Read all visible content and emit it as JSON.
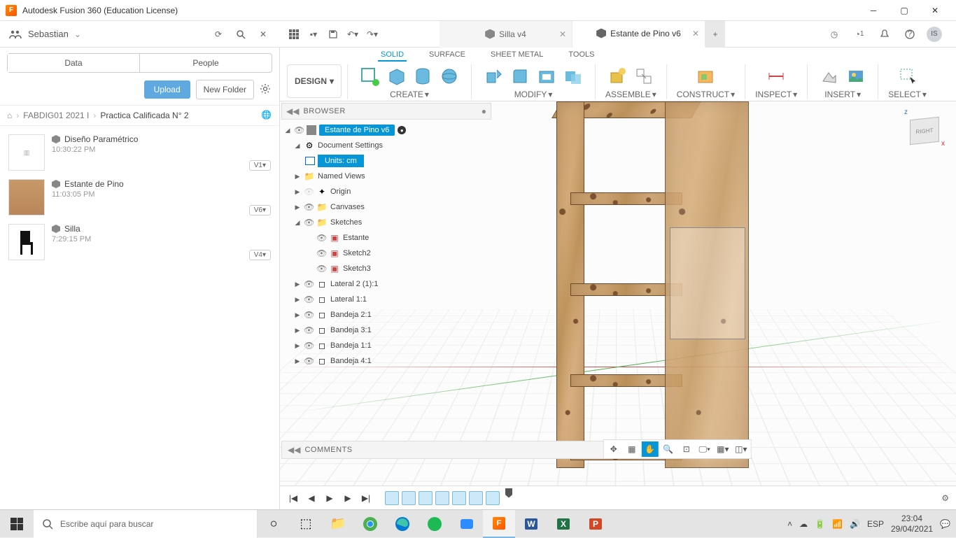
{
  "window": {
    "title": "Autodesk Fusion 360 (Education License)"
  },
  "user": {
    "name": "Sebastian",
    "initials": "IS",
    "notif_count": "1"
  },
  "doctabs": [
    {
      "label": "Silla v4",
      "active": false
    },
    {
      "label": "Estante de Pino v6",
      "active": true
    }
  ],
  "sidepanel": {
    "tabs": {
      "data": "Data",
      "people": "People"
    },
    "upload": "Upload",
    "newfolder": "New Folder",
    "crumbs": {
      "a": "FABDIG01 2021 I",
      "b": "Practica Calificada N° 2"
    },
    "files": [
      {
        "name": "Diseño Paramétrico",
        "time": "10:30:22 PM",
        "ver": "V1▾",
        "thumb": "param"
      },
      {
        "name": "Estante de Pino",
        "time": "11:03:05 PM",
        "ver": "V6▾",
        "thumb": "wood"
      },
      {
        "name": "Silla",
        "time": "7:29:15 PM",
        "ver": "V4▾",
        "thumb": "chair"
      }
    ]
  },
  "ribbon": {
    "design": "DESIGN",
    "tabs": {
      "solid": "SOLID",
      "surface": "SURFACE",
      "sheet": "SHEET METAL",
      "tools": "TOOLS"
    },
    "groups": {
      "create": "CREATE",
      "modify": "MODIFY",
      "assemble": "ASSEMBLE",
      "construct": "CONSTRUCT",
      "inspect": "INSPECT",
      "insert": "INSERT",
      "select": "SELECT"
    }
  },
  "browser": {
    "title": "BROWSER",
    "root": "Estante de Pino v6",
    "docset": "Document Settings",
    "units": "Units: cm",
    "named": "Named Views",
    "origin": "Origin",
    "canvases": "Canvases",
    "sketches": "Sketches",
    "sk": [
      "Estante",
      "Sketch2",
      "Sketch3"
    ],
    "bodies": [
      "Lateral 2 (1):1",
      "Lateral 1:1",
      "Bandeja 2:1",
      "Bandeja 3:1",
      "Bandeja 1:1",
      "Bandeja 4:1"
    ]
  },
  "comments": "COMMENTS",
  "viewcube": "RIGHT",
  "taskbar": {
    "search": "Escribe aquí para buscar",
    "lang": "ESP",
    "time": "23:04",
    "date": "29/04/2021"
  }
}
